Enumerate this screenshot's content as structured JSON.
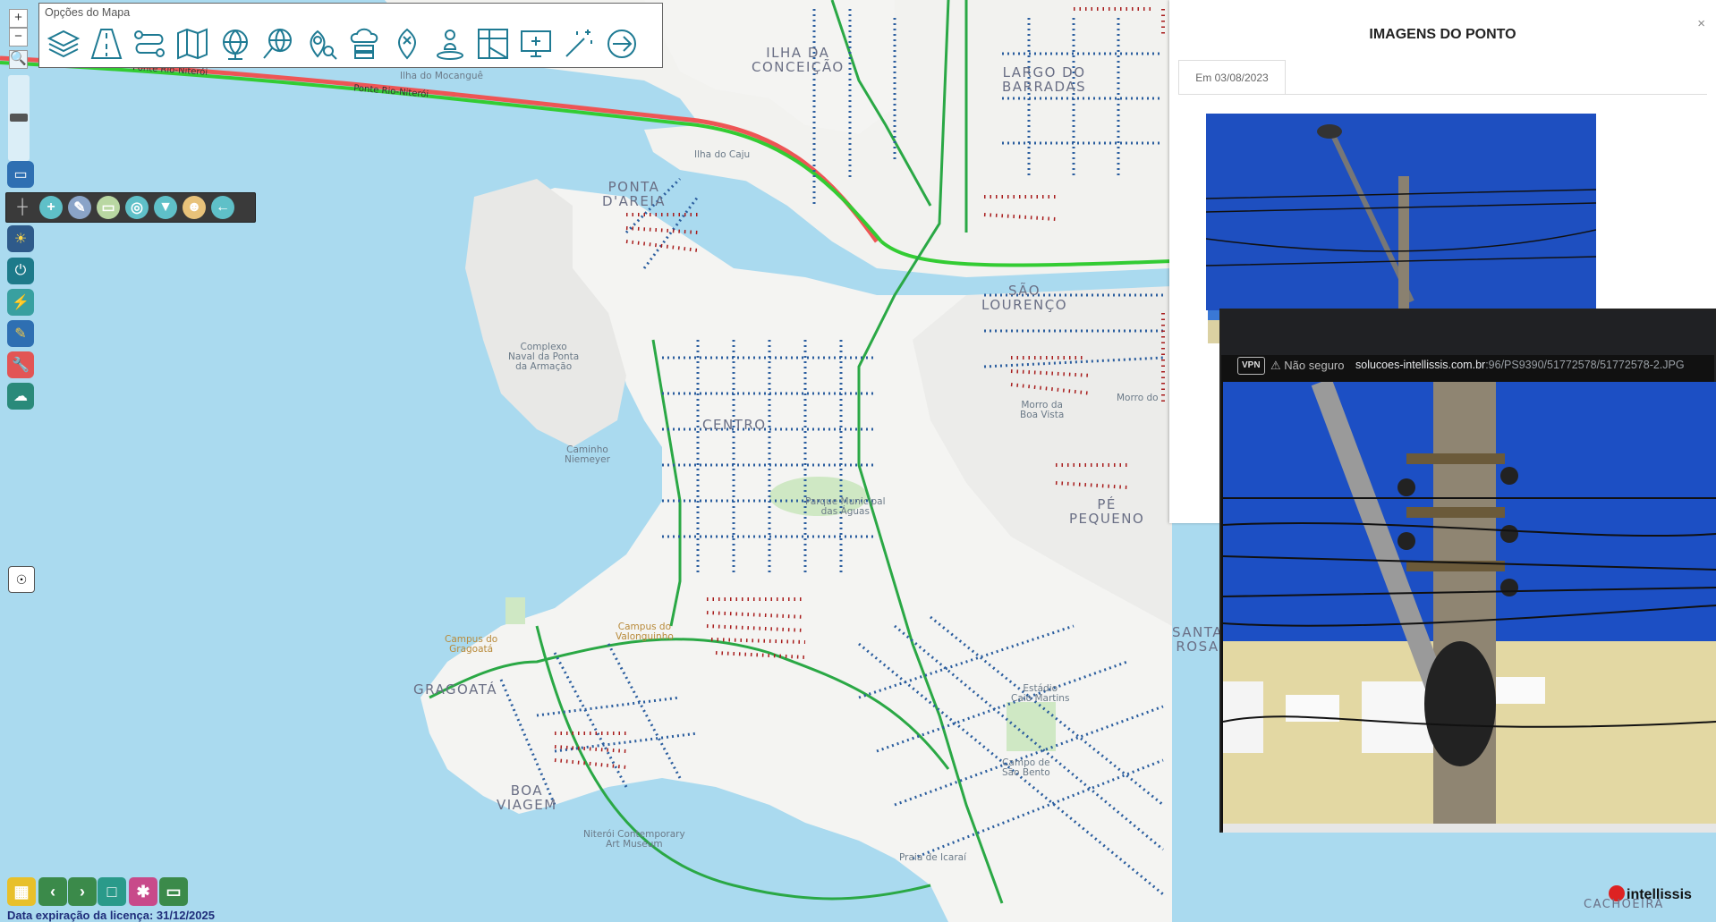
{
  "toolbar": {
    "title": "Opções do Mapa",
    "icons": [
      "layers-icon",
      "road-icon",
      "route-icon",
      "map-icon",
      "globe-icon",
      "globe-search-icon",
      "location-search-icon",
      "cloud-server-icon",
      "map-pin-icon",
      "person-pin-icon",
      "building-map-icon",
      "monitor-icon",
      "magic-wand-icon",
      "arrow-right-icon"
    ]
  },
  "zoom": {
    "in": "+",
    "out": "−"
  },
  "map_labels": {
    "ilha_conceicao": "ILHA DA\nCONCEIÇÃO",
    "largo_barradas": "LARGO DO\nBARRADAS",
    "ilha_mocangue": "Ilha do Mocanguê",
    "ilha_caju": "Ilha do Caju",
    "ponta_areia": "PONTA\nD'AREIA",
    "sao_lourenco": "SÃO\nLOURENÇO",
    "complexo_naval": "Complexo\nNaval da Ponta\nda Armação",
    "centro": "CENTRO",
    "caminho_niemeyer": "Caminho\nNiemeyer",
    "parque_aguas": "Parque Municipal\ndas Águas",
    "boa_vista": "Morro da\nBoa Vista",
    "morro": "Morro do",
    "pe_pequeno": "PÉ\nPEQUENO",
    "campus_gragoata": "Campus do\nGragoatá",
    "gragoata": "GRAGOATÁ",
    "boa_viagem": "BOA\nVIAGEM",
    "mac": "Niterói Contemporary\nArt Museum",
    "praia_icarai": "Praia de Icaraí",
    "santa_rosa": "SANTA\nROSA",
    "estadio": "Estádio\nCaio Martins",
    "campo_sao_bento": "Campo de\nSão Bento",
    "valonguinho": "Campus do\nValonguinho",
    "ponte1": "Ponte Rio-Niterói",
    "ponte2": "Ponte Rio-Niterói",
    "cacha": "CACHOEIRA"
  },
  "license": "Data expiração da licença: 31/12/2025",
  "panel": {
    "title": "IMAGENS DO PONTO",
    "close": "×",
    "tab": "Em 03/08/2023"
  },
  "popup": {
    "vpn": "VPN",
    "security": "Não seguro",
    "url_host": "solucoes-intellissis.com.br",
    "url_path": ":96/PS9390/51772578/51772578-2.JPG"
  },
  "brand": "intellissis",
  "colors": {
    "water": "#aadaef",
    "land": "#f4f4f2",
    "accent": "#1e7a93"
  }
}
